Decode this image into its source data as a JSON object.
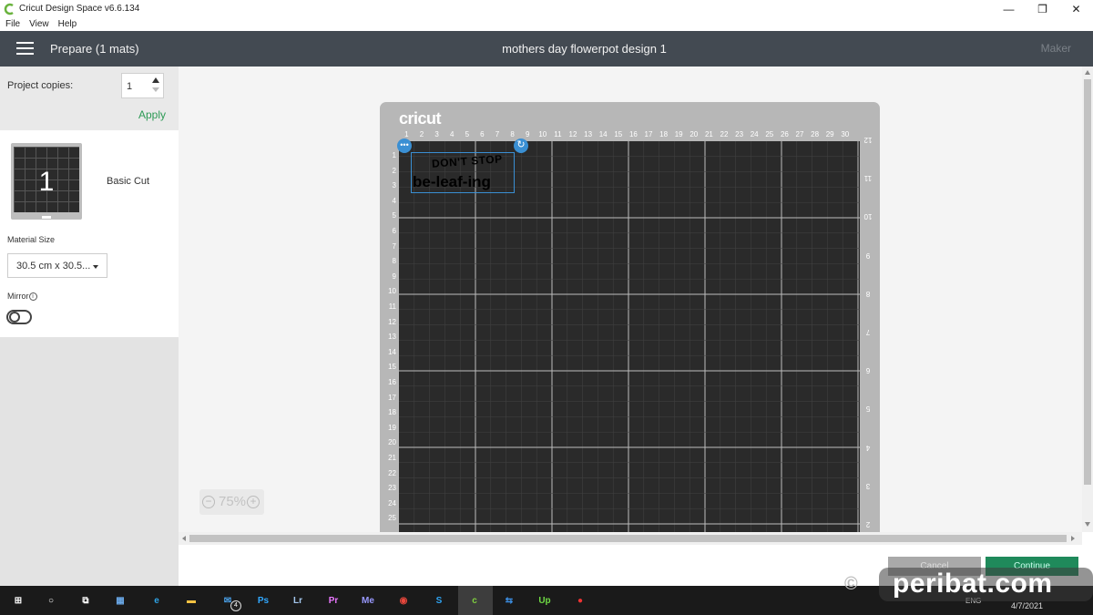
{
  "window": {
    "app_title": "Cricut Design Space  v6.6.134",
    "menu": [
      "File",
      "View",
      "Help"
    ],
    "minimize_icon": "—",
    "maximize_icon": "❐",
    "close_icon": "✕"
  },
  "header": {
    "prepare_label": "Prepare (1 mats)",
    "document_title": "mothers day flowerpot design 1",
    "machine_label": "Maker"
  },
  "left_panel": {
    "project_copies_label": "Project copies:",
    "project_copies_value": "1",
    "apply_label": "Apply",
    "mat_number": "1",
    "mat_type": "Basic Cut",
    "material_size_label": "Material Size",
    "material_size_value": "30.5 cm x 30.5...",
    "mirror_label": "Mirror",
    "mirror_info_icon": "i",
    "mirror_enabled": false
  },
  "mat": {
    "brand": "cricut",
    "top_ruler": [
      "1",
      "2",
      "3",
      "4",
      "5",
      "6",
      "7",
      "8",
      "9",
      "10",
      "11",
      "12",
      "13",
      "14",
      "15",
      "16",
      "17",
      "18",
      "19",
      "20",
      "21",
      "22",
      "23",
      "24",
      "25",
      "26",
      "27",
      "28",
      "29",
      "30"
    ],
    "left_ruler": [
      "1",
      "2",
      "3",
      "4",
      "5",
      "6",
      "7",
      "8",
      "9",
      "10",
      "11",
      "12",
      "13",
      "14",
      "15",
      "16",
      "17",
      "18",
      "19",
      "20",
      "21",
      "22",
      "23",
      "24",
      "25"
    ],
    "right_ruler": [
      "12",
      "11",
      "10",
      "9",
      "8",
      "7",
      "6",
      "5",
      "4",
      "3",
      "2"
    ],
    "design_text_line1": "DON'T STOP",
    "design_text_line2": "be-leaf-ing",
    "handle_more": "•••",
    "handle_rotate": "↻"
  },
  "zoom": {
    "value": "75%",
    "minus": "−",
    "plus": "+"
  },
  "footer": {
    "cancel_label": "Cancel",
    "continue_label": "Continue"
  },
  "watermark": {
    "text": "peribat.com"
  },
  "taskbar": {
    "items": [
      {
        "name": "start-icon",
        "glyph": "⊞",
        "color": "#ffffff"
      },
      {
        "name": "search-icon",
        "glyph": "○",
        "color": "#ffffff"
      },
      {
        "name": "task-view-icon",
        "glyph": "⧉",
        "color": "#ffffff"
      },
      {
        "name": "calculator-icon",
        "glyph": "▦",
        "color": "#6aa8e8"
      },
      {
        "name": "edge-icon",
        "glyph": "e",
        "color": "#2fa4e7"
      },
      {
        "name": "file-explorer-icon",
        "glyph": "▬",
        "color": "#f5c242"
      },
      {
        "name": "mail-icon",
        "glyph": "✉",
        "color": "#4aa0e8"
      },
      {
        "name": "photoshop-icon",
        "glyph": "Ps",
        "color": "#31a8ff"
      },
      {
        "name": "lightroom-icon",
        "glyph": "Lr",
        "color": "#a4c8ef"
      },
      {
        "name": "premiere-icon",
        "glyph": "Pr",
        "color": "#ea77ff"
      },
      {
        "name": "media-encoder-icon",
        "glyph": "Me",
        "color": "#9999ff"
      },
      {
        "name": "chrome-icon",
        "glyph": "◉",
        "color": "#e9473c"
      },
      {
        "name": "skype-icon",
        "glyph": "S",
        "color": "#2ea3f2"
      },
      {
        "name": "cricut-icon",
        "glyph": "c",
        "color": "#7fcf3f"
      },
      {
        "name": "teamviewer-icon",
        "glyph": "⇆",
        "color": "#3b8de0"
      },
      {
        "name": "upwork-icon",
        "glyph": "Up",
        "color": "#6fda44"
      },
      {
        "name": "record-icon",
        "glyph": "●",
        "color": "#e33"
      }
    ],
    "mail_badge": "4",
    "tray_text": "ENG",
    "date": "4/7/2021"
  }
}
